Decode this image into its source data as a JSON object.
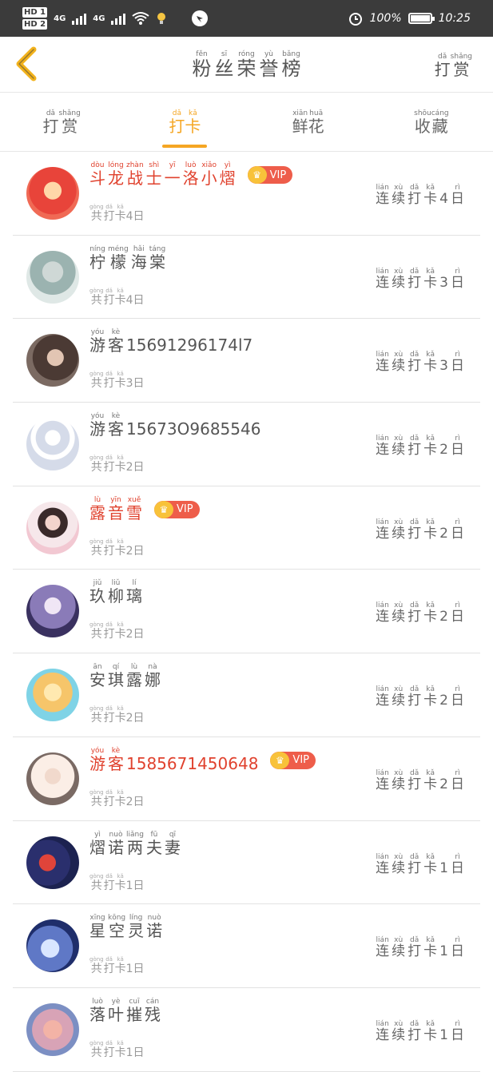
{
  "status_bar": {
    "hd1": "HD 1",
    "hd2": "HD 2",
    "signal1": "4G",
    "signal2": "4G",
    "battery": "100%",
    "time": "10:25"
  },
  "header": {
    "title": [
      {
        "pinyin": "fěn",
        "han": "粉"
      },
      {
        "pinyin": "sī",
        "han": "丝"
      },
      {
        "pinyin": "róng",
        "han": "荣"
      },
      {
        "pinyin": "yù",
        "han": "誉"
      },
      {
        "pinyin": "bǎng",
        "han": "榜"
      }
    ],
    "right_action": [
      {
        "pinyin": "dǎ",
        "han": "打"
      },
      {
        "pinyin": "shǎng",
        "han": "赏"
      }
    ]
  },
  "tabs": [
    {
      "chars": [
        {
          "pinyin": "dǎ",
          "han": "打"
        },
        {
          "pinyin": "shǎng",
          "han": "赏"
        }
      ],
      "active": false
    },
    {
      "chars": [
        {
          "pinyin": "dǎ",
          "han": "打"
        },
        {
          "pinyin": "kǎ",
          "han": "卡"
        }
      ],
      "active": true
    },
    {
      "chars": [
        {
          "pinyin": "xiān",
          "han": "鲜"
        },
        {
          "pinyin": "huā",
          "han": "花"
        }
      ],
      "active": false
    },
    {
      "chars": [
        {
          "pinyin": "shōu",
          "han": "收"
        },
        {
          "pinyin": "cáng",
          "han": "藏"
        }
      ],
      "active": false
    }
  ],
  "vip_label": "VIP",
  "users": [
    {
      "name": [
        {
          "p": "dòu",
          "h": "斗"
        },
        {
          "p": "lóng",
          "h": "龙"
        },
        {
          "p": "zhàn",
          "h": "战"
        },
        {
          "p": "shì",
          "h": "士"
        },
        {
          "p": "yī",
          "h": "一"
        },
        {
          "p": "luò",
          "h": "洛"
        },
        {
          "p": "xiǎo",
          "h": "小"
        },
        {
          "p": "yì",
          "h": "熠"
        }
      ],
      "vip": true,
      "total_days": "4",
      "streak_days": "4"
    },
    {
      "name": [
        {
          "p": "níng",
          "h": "柠"
        },
        {
          "p": "méng",
          "h": "檬"
        },
        {
          "p": "hǎi",
          "h": "海"
        },
        {
          "p": "táng",
          "h": "棠"
        }
      ],
      "vip": false,
      "total_days": "4",
      "streak_days": "3"
    },
    {
      "name": [
        {
          "p": "yóu",
          "h": "游"
        },
        {
          "p": "kè",
          "h": "客"
        },
        {
          "p": "",
          "h": "15691296174l7"
        }
      ],
      "vip": false,
      "total_days": "3",
      "streak_days": "3"
    },
    {
      "name": [
        {
          "p": "yóu",
          "h": "游"
        },
        {
          "p": "kè",
          "h": "客"
        },
        {
          "p": "",
          "h": "15673O9685546"
        }
      ],
      "vip": false,
      "total_days": "2",
      "streak_days": "2"
    },
    {
      "name": [
        {
          "p": "lù",
          "h": "露"
        },
        {
          "p": "yīn",
          "h": "音"
        },
        {
          "p": "xuě",
          "h": "雪"
        }
      ],
      "vip": true,
      "total_days": "2",
      "streak_days": "2"
    },
    {
      "name": [
        {
          "p": "jiǔ",
          "h": "玖"
        },
        {
          "p": "liǔ",
          "h": "柳"
        },
        {
          "p": "lí",
          "h": "璃"
        }
      ],
      "vip": false,
      "total_days": "2",
      "streak_days": "2"
    },
    {
      "name": [
        {
          "p": "ān",
          "h": "安"
        },
        {
          "p": "qí",
          "h": "琪"
        },
        {
          "p": "lù",
          "h": "露"
        },
        {
          "p": "nà",
          "h": "娜"
        }
      ],
      "vip": false,
      "total_days": "2",
      "streak_days": "2"
    },
    {
      "name": [
        {
          "p": "yóu",
          "h": "游"
        },
        {
          "p": "kè",
          "h": "客"
        },
        {
          "p": "",
          "h": "1585671450648"
        }
      ],
      "vip": true,
      "total_days": "2",
      "streak_days": "2"
    },
    {
      "name": [
        {
          "p": "yì",
          "h": "熠"
        },
        {
          "p": "nuò",
          "h": "诺"
        },
        {
          "p": "liǎng",
          "h": "两"
        },
        {
          "p": "fū",
          "h": "夫"
        },
        {
          "p": "qī",
          "h": "妻"
        }
      ],
      "vip": false,
      "total_days": "1",
      "streak_days": "1"
    },
    {
      "name": [
        {
          "p": "xīng",
          "h": "星"
        },
        {
          "p": "kōng",
          "h": "空"
        },
        {
          "p": "líng",
          "h": "灵"
        },
        {
          "p": "nuò",
          "h": "诺"
        }
      ],
      "vip": false,
      "total_days": "1",
      "streak_days": "1"
    },
    {
      "name": [
        {
          "p": "luò",
          "h": "落"
        },
        {
          "p": "yè",
          "h": "叶"
        },
        {
          "p": "cuī",
          "h": "摧"
        },
        {
          "p": "cán",
          "h": "残"
        }
      ],
      "vip": false,
      "total_days": "1",
      "streak_days": "1"
    }
  ],
  "total_label": [
    {
      "p": "gòng",
      "h": "共"
    },
    {
      "p": "dǎ",
      "h": "打"
    },
    {
      "p": "kǎ",
      "h": "卡"
    }
  ],
  "total_suffix": "日",
  "streak_label": [
    {
      "p": "lián",
      "h": "连"
    },
    {
      "p": "xù",
      "h": "续"
    },
    {
      "p": "dǎ",
      "h": "打"
    },
    {
      "p": "kǎ",
      "h": "卡"
    }
  ],
  "streak_suffix": {
    "p": "rì",
    "h": "日"
  },
  "colors": {
    "accent": "#f5a623",
    "vip_name": "#e0422e",
    "vip_badge": "#ee5d4a"
  }
}
